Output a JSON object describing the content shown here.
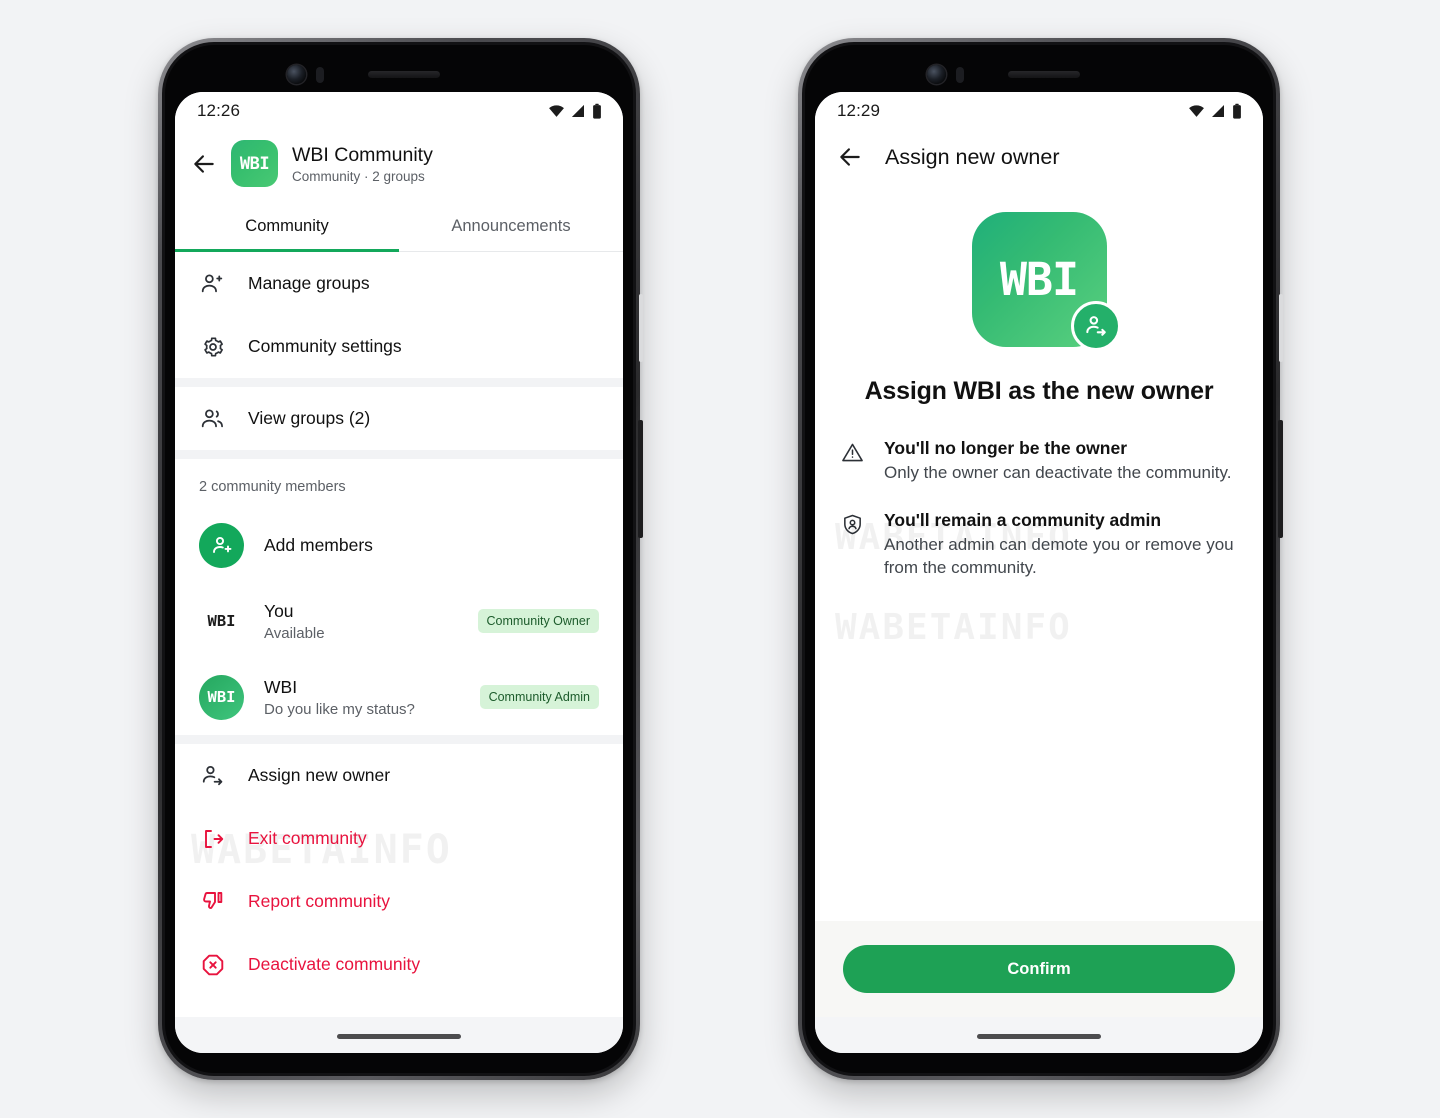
{
  "watermark": {
    "text": "WABETAINFO"
  },
  "colors": {
    "brand_green": "#13a85b",
    "confirm_green": "#1ea155",
    "danger_red": "#e8133e",
    "badge_bg": "#d6f3d8",
    "badge_text": "#1d5c2c"
  },
  "phone_left": {
    "status": {
      "time": "12:26",
      "icons": [
        "wifi-icon",
        "cellular-signal-icon",
        "battery-icon"
      ]
    },
    "appbar": {
      "back_icon": "back-arrow-icon",
      "avatar_text": "WBI",
      "title": "WBI Community",
      "subtitle": "Community · 2 groups"
    },
    "tabs": [
      {
        "label": "Community",
        "active": true
      },
      {
        "label": "Announcements",
        "active": false
      }
    ],
    "group_actions": [
      {
        "icon": "person-add-icon",
        "label": "Manage groups"
      },
      {
        "icon": "gear-icon",
        "label": "Community settings"
      }
    ],
    "view_groups": {
      "icon": "people-icon",
      "label": "View groups (2)"
    },
    "members_header": "2 community members",
    "add_members": {
      "icon": "person-add-filled-icon",
      "label": "Add members"
    },
    "members": [
      {
        "avatar_text": "WBI",
        "avatar_style": "plain",
        "name": "You",
        "status": "Available",
        "badge": "Community Owner"
      },
      {
        "avatar_text": "WBI",
        "avatar_style": "green",
        "name": "WBI",
        "status": "Do you like my status?",
        "badge": "Community Admin"
      }
    ],
    "danger_actions": [
      {
        "icon": "assign-owner-icon",
        "label": "Assign new owner",
        "danger": false
      },
      {
        "icon": "exit-icon",
        "label": "Exit community",
        "danger": true
      },
      {
        "icon": "thumbs-down-icon",
        "label": "Report community",
        "danger": true
      },
      {
        "icon": "octagon-x-icon",
        "label": "Deactivate community",
        "danger": true
      }
    ]
  },
  "phone_right": {
    "status": {
      "time": "12:29",
      "icons": [
        "wifi-icon",
        "cellular-signal-icon",
        "battery-icon"
      ]
    },
    "appbar": {
      "back_icon": "back-arrow-icon",
      "title": "Assign new owner"
    },
    "app_icon": {
      "text": "WBI",
      "badge_icon": "assign-owner-icon"
    },
    "heading": "Assign WBI as the new owner",
    "info_items": [
      {
        "icon": "warning-triangle-icon",
        "title": "You'll no longer be the owner",
        "desc": "Only the owner can deactivate the community."
      },
      {
        "icon": "shield-person-icon",
        "title": "You'll remain a community admin",
        "desc": "Another admin can demote you or remove you from the community."
      }
    ],
    "confirm_label": "Confirm"
  }
}
